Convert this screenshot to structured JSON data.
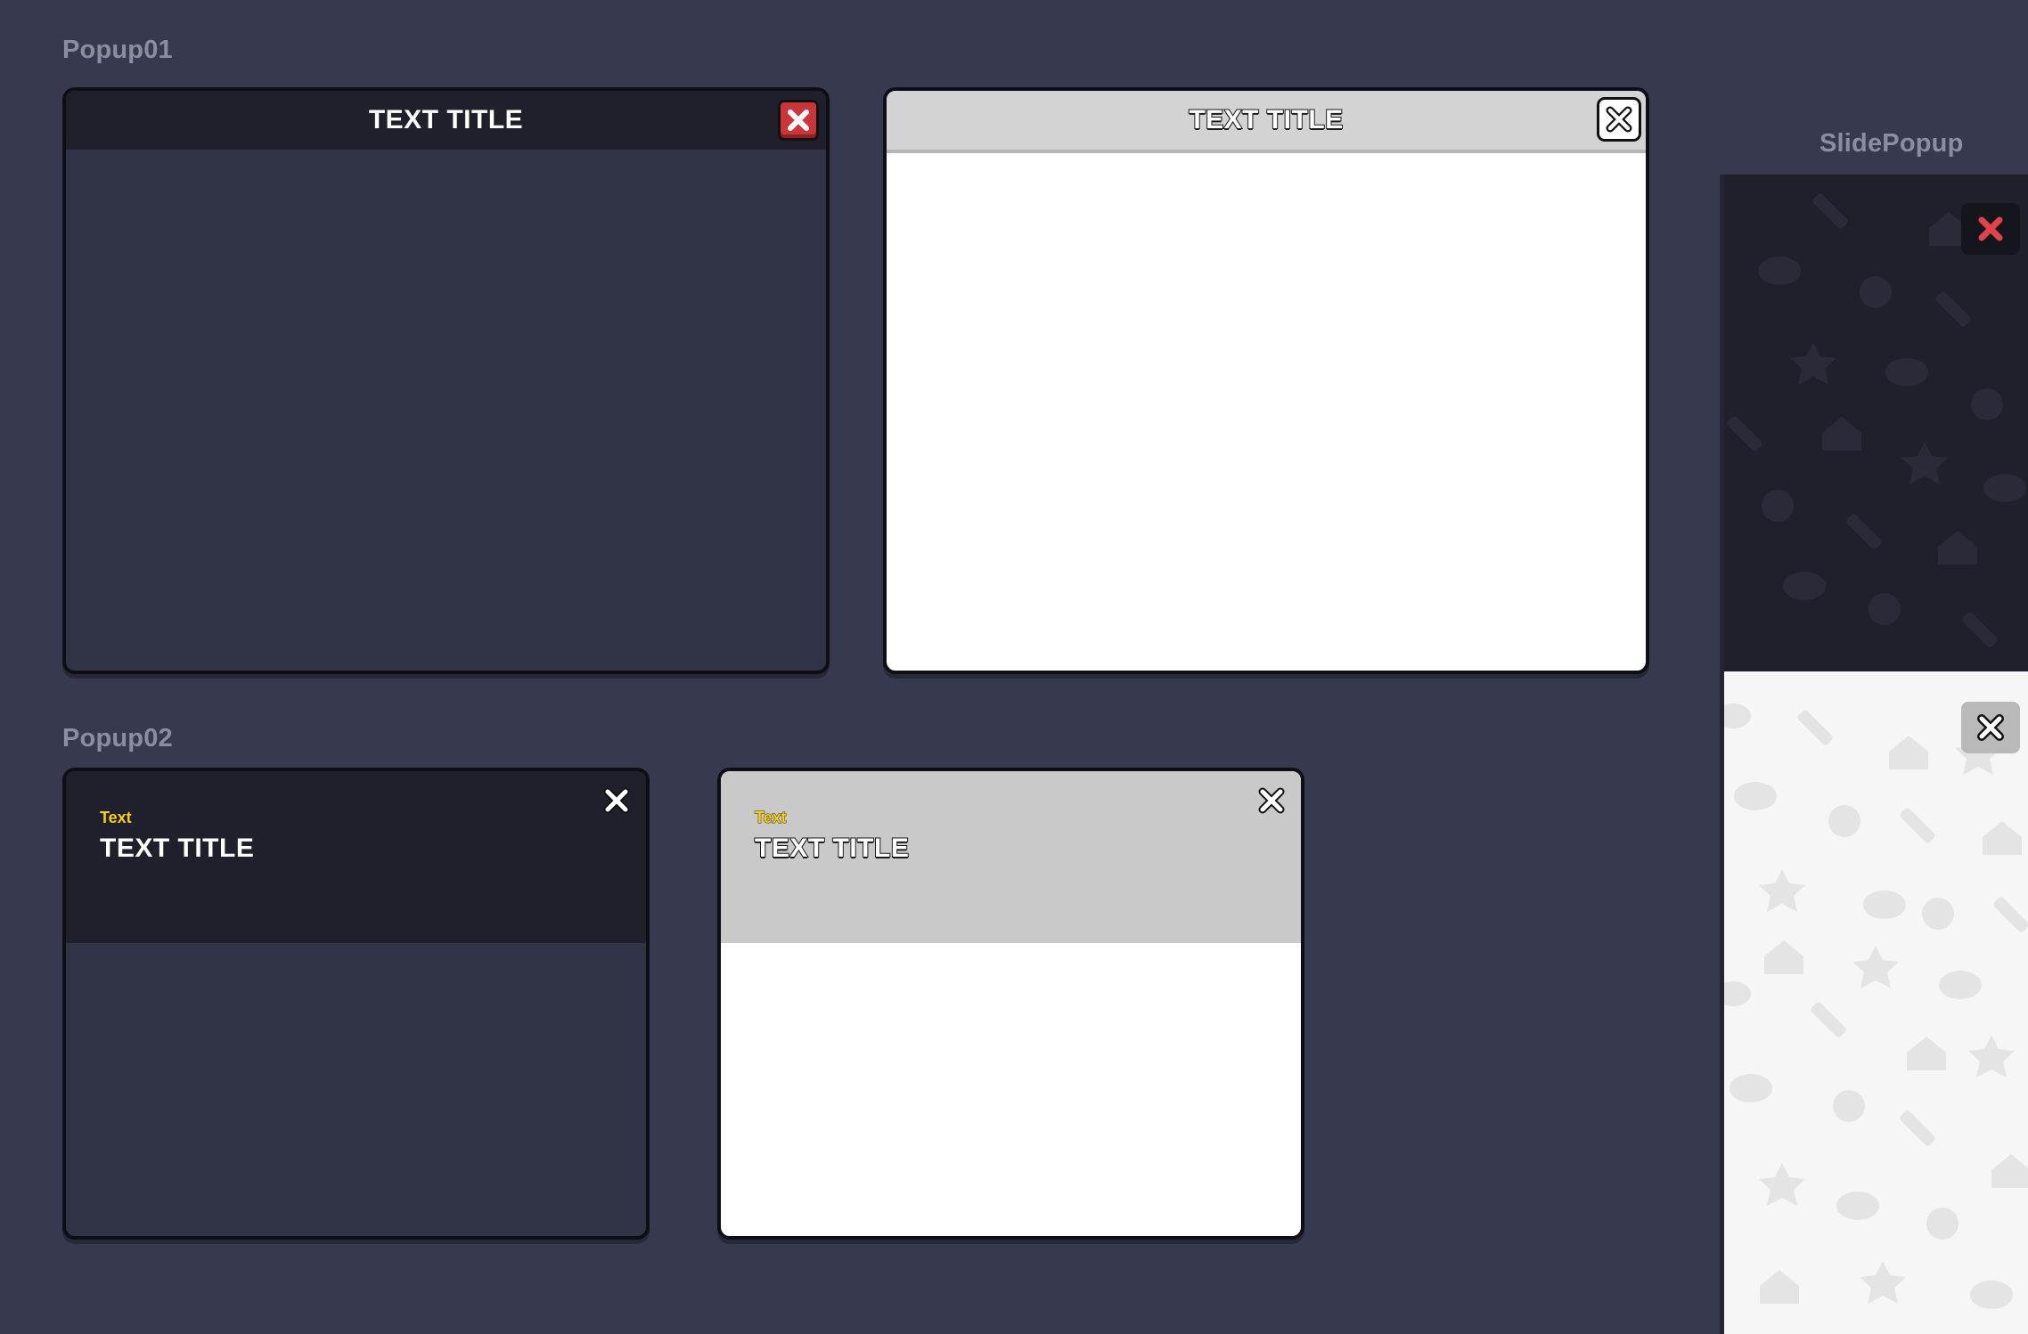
{
  "sections": {
    "popup01_label": "Popup01",
    "popup02_label": "Popup02",
    "slide_label": "SlidePopup"
  },
  "popup01": {
    "dark": {
      "title": "TEXT TITLE",
      "close_icon": "close-x-icon"
    },
    "light": {
      "title": "TEXT TITLE",
      "close_icon": "close-x-icon"
    }
  },
  "popup02": {
    "dark": {
      "subtext": "Text",
      "title": "TEXT TITLE",
      "close_icon": "close-x-icon"
    },
    "light": {
      "subtext": "Text",
      "title": "TEXT TITLE",
      "close_icon": "close-x-icon"
    }
  },
  "slide_popup": {
    "dark_close_icon": "close-x-icon",
    "light_close_icon": "close-x-icon",
    "pattern_icons": [
      "sword-icon",
      "bomb-icon",
      "star-icon",
      "house-icon",
      "fireball-icon"
    ]
  },
  "colors": {
    "background": "#373a4e",
    "panel_dark": "#313447",
    "header_dark": "#1f202b",
    "header_light": "#d3d3d3",
    "close_red": "#c9363a",
    "subtext_yellow": "#f5cf1a"
  }
}
